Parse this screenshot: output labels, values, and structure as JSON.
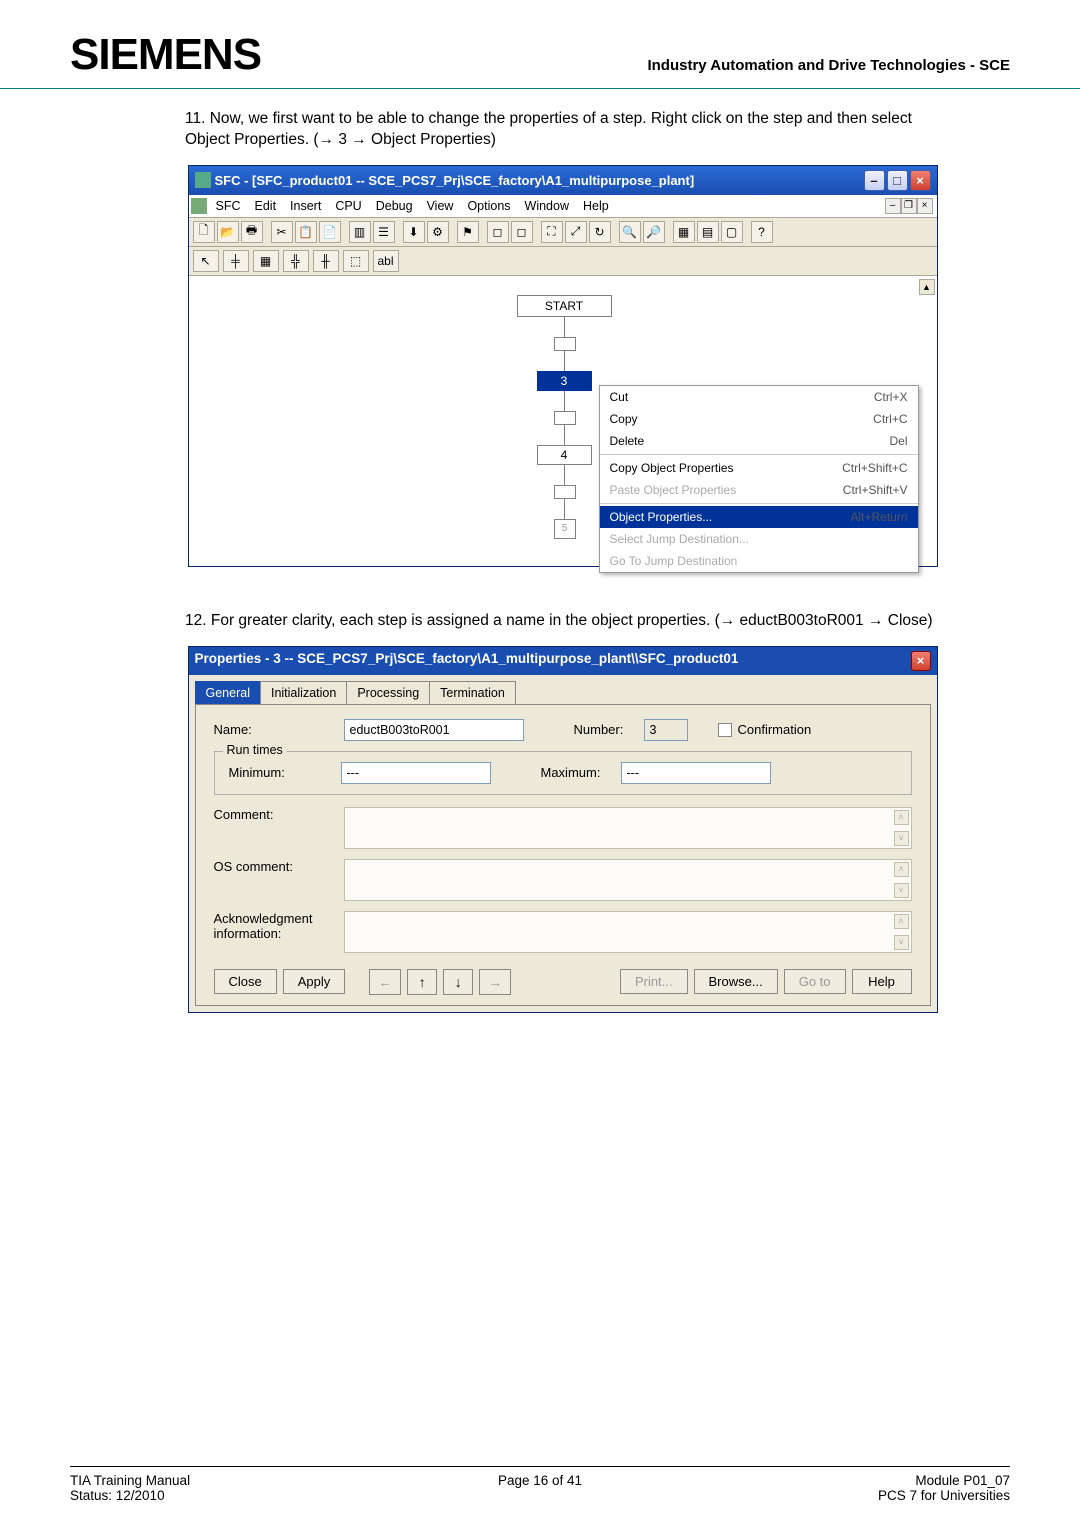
{
  "page": {
    "logo": "SIEMENS",
    "header_right": "Industry Automation and Drive Technologies - SCE",
    "item11": "11. Now, we first want to be able to change the properties of a step. Right click on the step and then select Object Properties. (→ 3 → Object Properties)",
    "item12": "12. For greater clarity, each step is assigned a name in the object properties.   (→ eductB003toR001 → Close)"
  },
  "sfc": {
    "title": "SFC - [SFC_product01 -- SCE_PCS7_Prj\\SCE_factory\\A1_multipurpose_plant]",
    "menus": [
      "SFC",
      "Edit",
      "Insert",
      "CPU",
      "Debug",
      "View",
      "Options",
      "Window",
      "Help"
    ],
    "toolbar2_labels": [
      "↖",
      "╪",
      "▦",
      "╬",
      "╫",
      "⬚",
      "abl"
    ],
    "node_start": "START",
    "node_selected": "3",
    "node_4": "4",
    "node_5": "5",
    "ctx": {
      "cut": "Cut",
      "cut_k": "Ctrl+X",
      "copy": "Copy",
      "copy_k": "Ctrl+C",
      "delete": "Delete",
      "delete_k": "Del",
      "copy_obj": "Copy Object Properties",
      "copy_obj_k": "Ctrl+Shift+C",
      "paste_obj": "Paste Object Properties",
      "paste_obj_k": "Ctrl+Shift+V",
      "obj_props": "Object Properties...",
      "obj_props_k": "Alt+Return",
      "sel_jump": "Select Jump Destination...",
      "go_jump": "Go To Jump Destination"
    }
  },
  "props": {
    "title": "Properties -  3 -- SCE_PCS7_Prj\\SCE_factory\\A1_multipurpose_plant\\\\SFC_product01",
    "tabs": {
      "general": "General",
      "init": "Initialization",
      "proc": "Processing",
      "term": "Termination"
    },
    "labels": {
      "name": "Name:",
      "number": "Number:",
      "confirmation": "Confirmation",
      "run_times": "Run times",
      "minimum": "Minimum:",
      "maximum": "Maximum:",
      "comment": "Comment:",
      "os_comment": "OS comment:",
      "ack": "Acknowledgment information:"
    },
    "values": {
      "name": "eductB003toR001",
      "number": "3",
      "minimum": "---",
      "maximum": "---"
    },
    "buttons": {
      "close": "Close",
      "apply": "Apply",
      "prev": "←",
      "up": "↑",
      "down": "↓",
      "next": "→",
      "print": "Print...",
      "browse": "Browse...",
      "goto": "Go to",
      "help": "Help"
    }
  },
  "footer": {
    "left1": "TIA Training Manual",
    "left2": "Status: 12/2010",
    "center": "Page 16 of 41",
    "right1": "Module P01_07",
    "right2": "PCS 7 for Universities"
  }
}
